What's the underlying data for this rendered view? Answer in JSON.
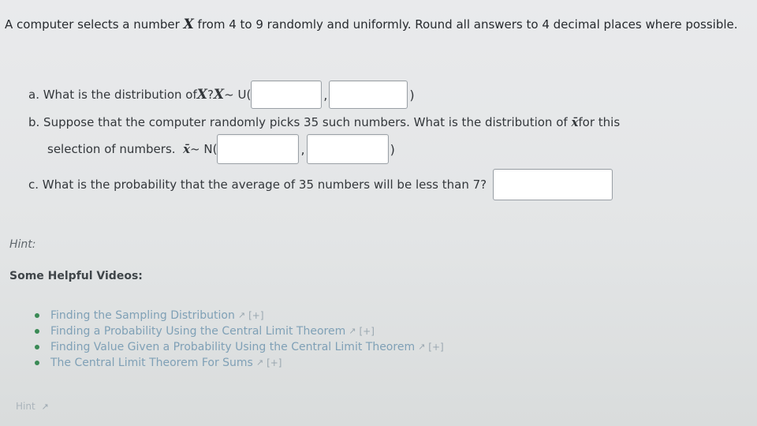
{
  "intro": {
    "text_before": "A computer selects a number ",
    "variable": "X",
    "text_after": " from 4 to 9 randomly and uniformly. Round all answers to 4 decimal places where possible."
  },
  "question_a": {
    "prefix": "a. What is the distribution of ",
    "var1": "X",
    "mid": "? ",
    "var2": "X",
    "dist": " ~ U(",
    "sep": ",",
    "close": ")"
  },
  "question_b": {
    "line1": "b. Suppose that the computer randomly picks 35 such numbers.  What is the distribution of",
    "var": "x̄",
    "line1_end": " for this",
    "line2": "selection of numbers.",
    "dist": " ~ N(",
    "sep": ",",
    "close": ")"
  },
  "question_c": {
    "text": "c. What is the probability that the average of 35 numbers will be less than 7?"
  },
  "hint_label": "Hint:",
  "videos_label": "Some Helpful Videos:",
  "videos": [
    {
      "title": "Finding the Sampling Distribution",
      "toggle": "[+]"
    },
    {
      "title": "Finding a Probability Using the Central Limit Theorem",
      "toggle": "[+]"
    },
    {
      "title": "Finding Value Given a Probability Using the Central Limit Theorem",
      "toggle": "[+]"
    },
    {
      "title": "The Central Limit Theorem For Sums",
      "toggle": "[+]"
    }
  ],
  "hint_link": "Hint"
}
